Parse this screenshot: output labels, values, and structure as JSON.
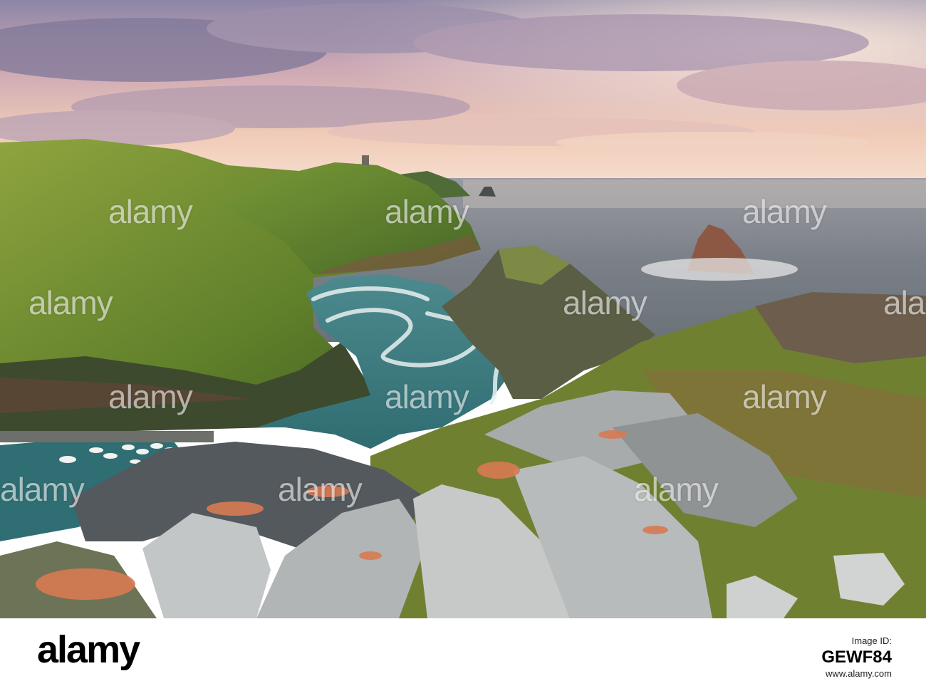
{
  "photo": {
    "subject": "coastal-harbour-landscape",
    "colors": {
      "sky_pink": "#e8b9b0",
      "sky_lilac": "#a99bb3",
      "sea_teal": "#3f7b80",
      "grass_green": "#6a8c33",
      "rock_grey": "#9ea1a3"
    }
  },
  "watermark": {
    "text": "alamy"
  },
  "footer": {
    "logo": "alamy",
    "image_id_label": "Image ID:",
    "image_id": "GEWF84",
    "url": "www.alamy.com"
  }
}
